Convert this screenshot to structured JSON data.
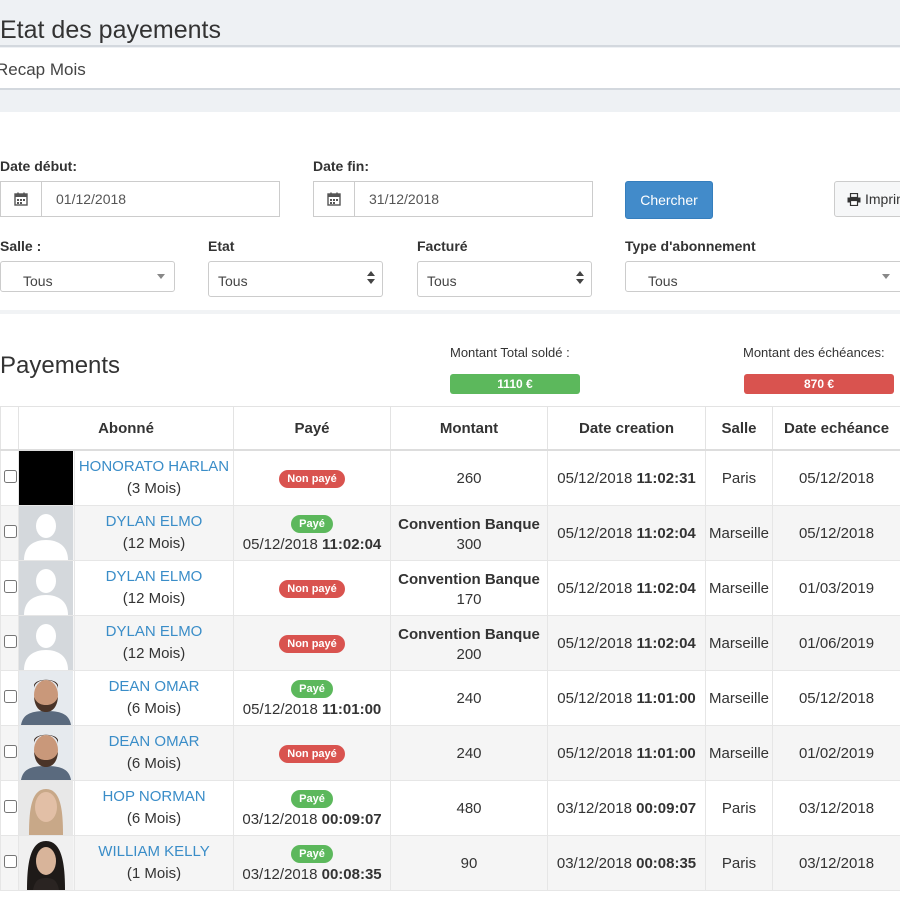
{
  "header": {
    "title": "Etat des payements",
    "recap_label": "Recap Mois"
  },
  "filters": {
    "date_debut_label": "Date début:",
    "date_debut_value": "01/12/2018",
    "date_fin_label": "Date fin:",
    "date_fin_value": "31/12/2018",
    "search_button": "Chercher",
    "print_button": "Imprimer",
    "salle_label": "Salle :",
    "salle_value": "Tous",
    "etat_label": "Etat",
    "etat_value": "Tous",
    "facture_label": "Facturé",
    "facture_value": "Tous",
    "type_label": "Type d'abonnement",
    "type_value": "Tous"
  },
  "summary": {
    "section_title": "Payements",
    "total_solde_label": "Montant Total soldé :",
    "total_solde_value": "1110 €",
    "echeances_label": "Montant des échéances:",
    "echeances_value": "870 €",
    "colors": {
      "paid": "#5cb85c",
      "unpaid": "#d9534f"
    }
  },
  "table": {
    "headers": [
      "Abonné",
      "Payé",
      "Montant",
      "Date creation",
      "Salle",
      "Date echéance"
    ],
    "rows": [
      {
        "avatar": "black",
        "name": "HONORATO HARLAN",
        "duration": "(3 Mois)",
        "status": "Non payé",
        "paid_date": "",
        "paid_time": "",
        "convention": "",
        "amount": "260",
        "created_date": "05/12/2018",
        "created_time": "11:02:31",
        "salle": "Paris",
        "due": "05/12/2018"
      },
      {
        "avatar": "placeholder",
        "name": "DYLAN ELMO",
        "duration": "(12 Mois)",
        "status": "Payé",
        "paid_date": "05/12/2018",
        "paid_time": "11:02:04",
        "convention": "Convention Banque",
        "amount": "300",
        "created_date": "05/12/2018",
        "created_time": "11:02:04",
        "salle": "Marseille",
        "due": "05/12/2018"
      },
      {
        "avatar": "placeholder",
        "name": "DYLAN ELMO",
        "duration": "(12 Mois)",
        "status": "Non payé",
        "paid_date": "",
        "paid_time": "",
        "convention": "Convention Banque",
        "amount": "170",
        "created_date": "05/12/2018",
        "created_time": "11:02:04",
        "salle": "Marseille",
        "due": "01/03/2019"
      },
      {
        "avatar": "placeholder",
        "name": "DYLAN ELMO",
        "duration": "(12 Mois)",
        "status": "Non payé",
        "paid_date": "",
        "paid_time": "",
        "convention": "Convention Banque",
        "amount": "200",
        "created_date": "05/12/2018",
        "created_time": "11:02:04",
        "salle": "Marseille",
        "due": "01/06/2019"
      },
      {
        "avatar": "man-beard",
        "name": "DEAN OMAR",
        "duration": "(6 Mois)",
        "status": "Payé",
        "paid_date": "05/12/2018",
        "paid_time": "11:01:00",
        "convention": "",
        "amount": "240",
        "created_date": "05/12/2018",
        "created_time": "11:01:00",
        "salle": "Marseille",
        "due": "05/12/2018"
      },
      {
        "avatar": "man-beard",
        "name": "DEAN OMAR",
        "duration": "(6 Mois)",
        "status": "Non payé",
        "paid_date": "",
        "paid_time": "",
        "convention": "",
        "amount": "240",
        "created_date": "05/12/2018",
        "created_time": "11:01:00",
        "salle": "Marseille",
        "due": "01/02/2019"
      },
      {
        "avatar": "woman-light",
        "name": "HOP NORMAN",
        "duration": "(6 Mois)",
        "status": "Payé",
        "paid_date": "03/12/2018",
        "paid_time": "00:09:07",
        "convention": "",
        "amount": "480",
        "created_date": "03/12/2018",
        "created_time": "00:09:07",
        "salle": "Paris",
        "due": "03/12/2018"
      },
      {
        "avatar": "woman-dark",
        "name": "WILLIAM KELLY",
        "duration": "(1 Mois)",
        "status": "Payé",
        "paid_date": "03/12/2018",
        "paid_time": "00:08:35",
        "convention": "",
        "amount": "90",
        "created_date": "03/12/2018",
        "created_time": "00:08:35",
        "salle": "Paris",
        "due": "03/12/2018"
      }
    ]
  },
  "icons": {
    "calendar": "calendar-icon",
    "print": "printer-icon"
  }
}
